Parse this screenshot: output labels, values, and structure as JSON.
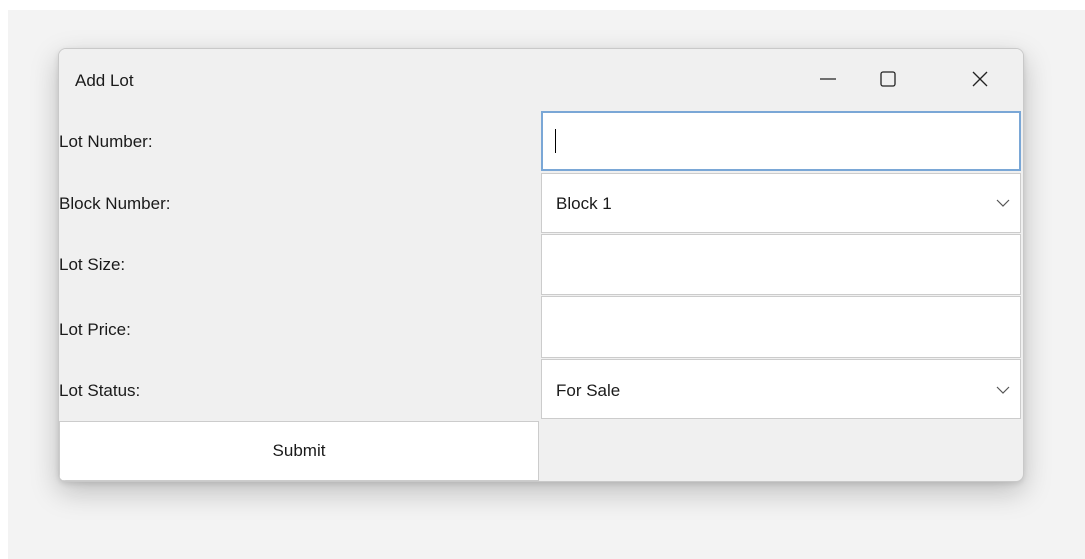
{
  "window": {
    "title": "Add Lot",
    "controls": {
      "minimize_icon": "minimize-icon",
      "maximize_icon": "maximize-icon",
      "close_icon": "close-icon"
    }
  },
  "form": {
    "lot_number": {
      "label": "Lot Number:",
      "value": ""
    },
    "block_number": {
      "label": "Block Number:",
      "selected": "Block 1"
    },
    "lot_size": {
      "label": "Lot Size:",
      "value": ""
    },
    "lot_price": {
      "label": "Lot Price:",
      "value": ""
    },
    "lot_status": {
      "label": "Lot Status:",
      "selected": "For Sale"
    },
    "submit_label": "Submit"
  },
  "colors": {
    "background": "#f0f0f0",
    "field_background": "#ffffff",
    "focus_border": "#7aa7d6"
  }
}
